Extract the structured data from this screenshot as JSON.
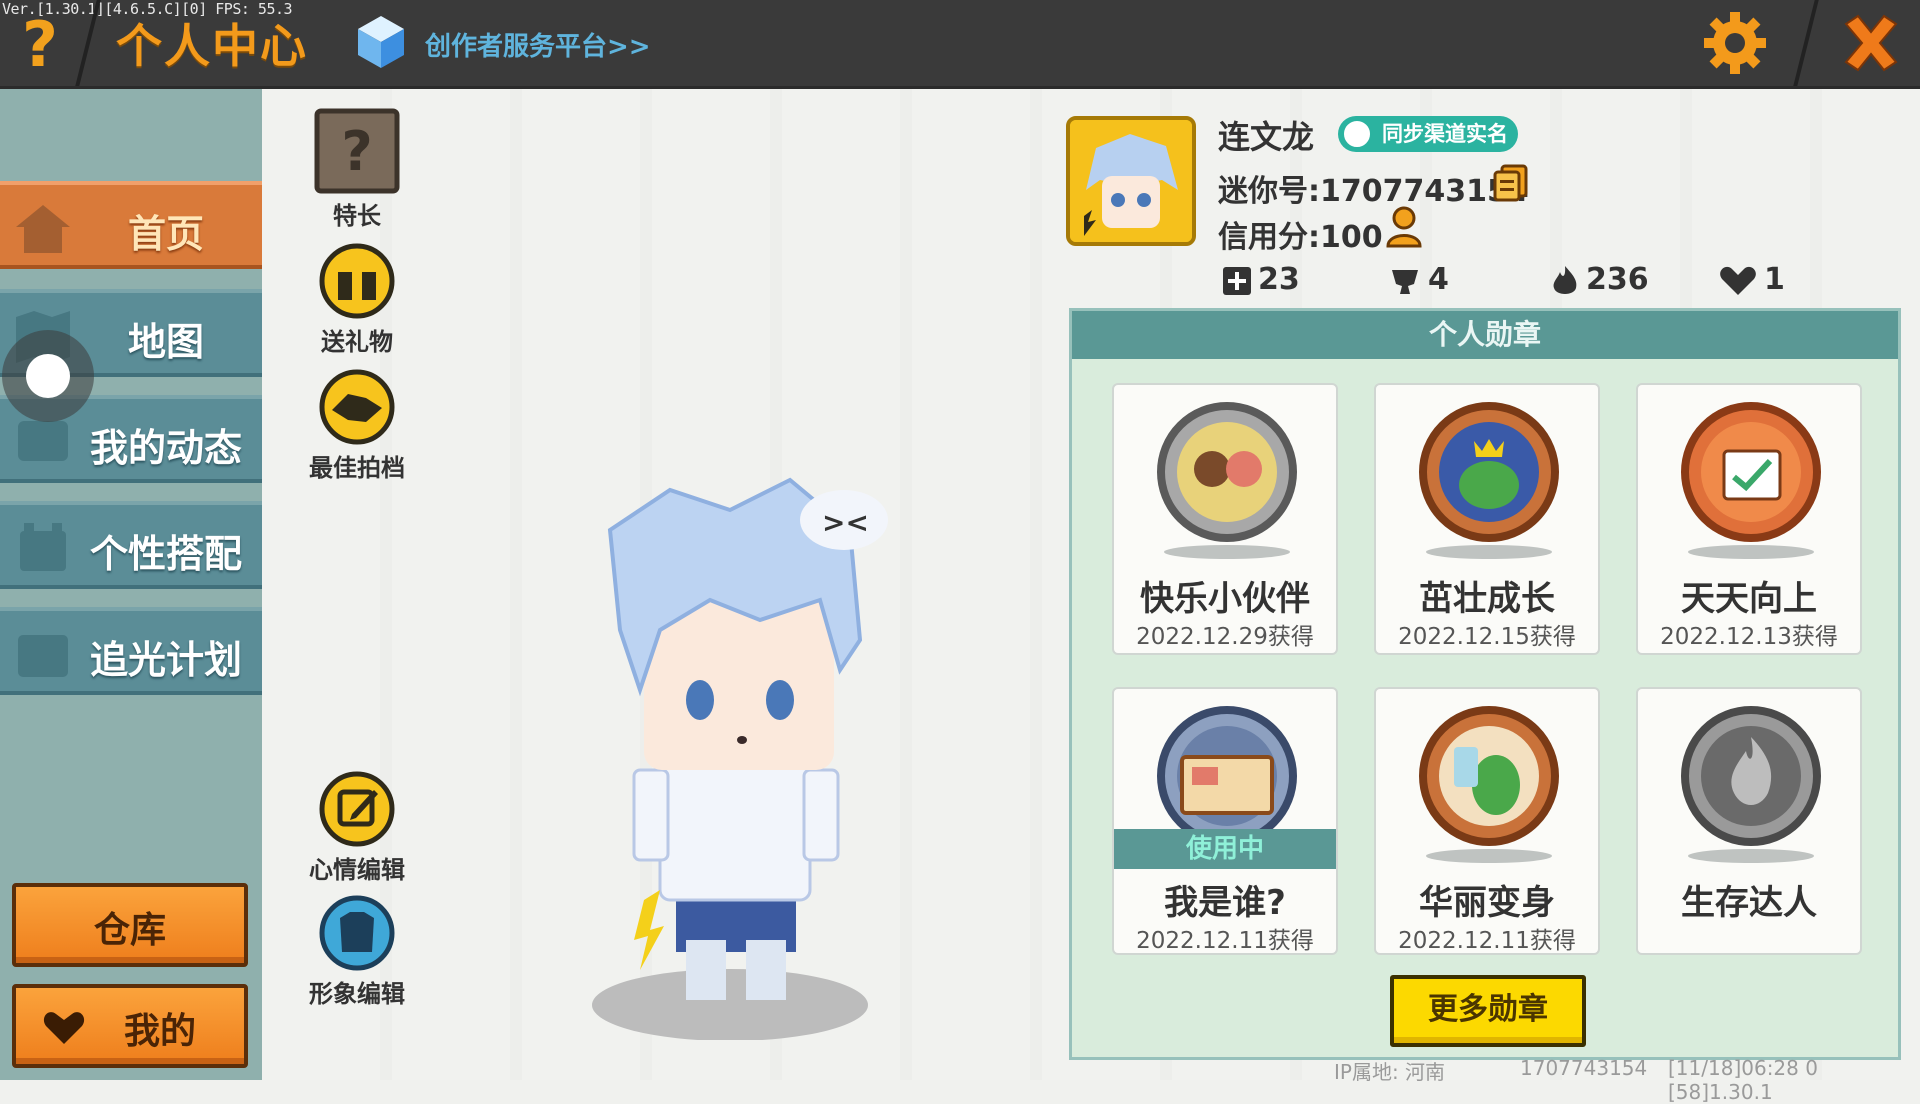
{
  "topbar": {
    "version": "Ver.[1.30.1][4.6.5.C][0] FPS: 55.3",
    "title": "个人中心",
    "creator_link": "创作者服务平台>>",
    "accent": "#f39a1b"
  },
  "sidebar": {
    "items": [
      {
        "label": "首页",
        "icon": "home-icon",
        "active": true
      },
      {
        "label": "地图",
        "icon": "map-icon",
        "active": false
      },
      {
        "label": "我的动态",
        "icon": "feed-icon",
        "active": false
      },
      {
        "label": "个性搭配",
        "icon": "outfit-icon",
        "active": false
      },
      {
        "label": "追光计划",
        "icon": "plan-icon",
        "active": false
      }
    ],
    "warehouse_label": "仓库",
    "mine_label": "我的"
  },
  "actions": [
    {
      "label": "特长",
      "icon": "question-box-icon"
    },
    {
      "label": "送礼物",
      "icon": "gift-icon"
    },
    {
      "label": "最佳拍档",
      "icon": "handshake-icon"
    },
    {
      "label": "心情编辑",
      "icon": "edit-icon"
    },
    {
      "label": "形象编辑",
      "icon": "outfit-edit-icon"
    }
  ],
  "profile": {
    "name": "连文龙",
    "realname_badge": "同步渠道实名",
    "mini_id": "迷你号:1707743154",
    "credit": "信用分:100",
    "stats": [
      {
        "icon": "plus-icon",
        "value": "23"
      },
      {
        "icon": "trophy-icon",
        "value": "4"
      },
      {
        "icon": "flame-icon",
        "value": "236"
      },
      {
        "icon": "heart-icon",
        "value": "1"
      }
    ]
  },
  "medals": {
    "header": "个人勋章",
    "items": [
      {
        "name": "快乐小伙伴",
        "date": "2022.12.29获得",
        "in_use": false,
        "color": "#9a9a9a"
      },
      {
        "name": "茁壮成长",
        "date": "2022.12.15获得",
        "in_use": false,
        "color": "#c9723a"
      },
      {
        "name": "天天向上",
        "date": "2022.12.13获得",
        "in_use": false,
        "color": "#e0703a"
      },
      {
        "name": "我是谁?",
        "date": "2022.12.11获得",
        "in_use": true,
        "color": "#556a8a"
      },
      {
        "name": "华丽变身",
        "date": "2022.12.11获得",
        "in_use": false,
        "color": "#c9723a"
      },
      {
        "name": "生存达人",
        "date": "",
        "in_use": false,
        "color": "#7a7a7a"
      }
    ],
    "in_use_label": "使用中",
    "more_label": "更多勋章"
  },
  "footer": {
    "ip": "IP属地: 河南",
    "id": "1707743154",
    "info": "[11/18]06:28 0   [58]1.30.1"
  }
}
